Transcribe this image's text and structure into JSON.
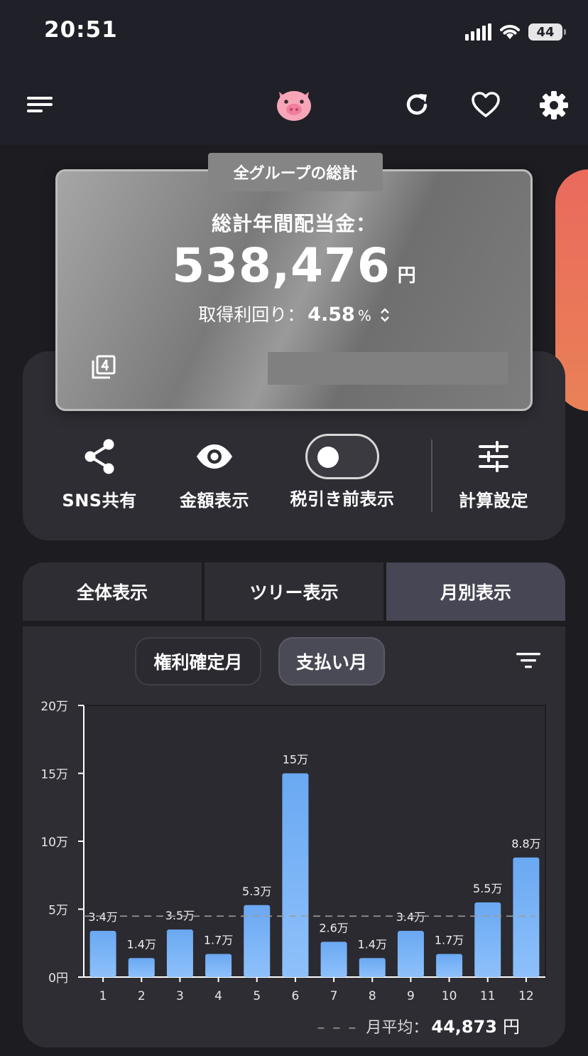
{
  "status_bar": {
    "time": "20:51",
    "battery": "44"
  },
  "app_bar": {
    "menu_icon": "hamburger-menu-icon",
    "logo_icon": "piggy-bank-icon",
    "refresh_icon": "refresh-icon",
    "favorite_icon": "heart-icon",
    "settings_icon": "gear-icon"
  },
  "total_card": {
    "tag": "全グループの総計",
    "label": "総計年間配当金：",
    "amount": "538,476",
    "unit": "円",
    "yield_label": "取得利回り：",
    "yield_value": "4.58",
    "yield_unit": "%",
    "group_count_icon": "group-count-4-icon"
  },
  "controls": {
    "share_label": "SNS共有",
    "amount_label": "金額表示",
    "pretax_label": "税引き前表示",
    "pretax_enabled": false,
    "calc_label": "計算設定"
  },
  "tabs": [
    {
      "label": "全体表示",
      "active": false
    },
    {
      "label": "ツリー表示",
      "active": false
    },
    {
      "label": "月別表示",
      "active": true
    }
  ],
  "chips": {
    "kenri": "権利確定月",
    "shiharai": "支払い月",
    "selected": "支払い月"
  },
  "chart_data": {
    "type": "bar",
    "categories": [
      "1",
      "2",
      "3",
      "4",
      "5",
      "6",
      "7",
      "8",
      "9",
      "10",
      "11",
      "12"
    ],
    "values": [
      34000,
      14000,
      35000,
      17000,
      53000,
      150000,
      26000,
      14000,
      34000,
      17000,
      55000,
      88000
    ],
    "data_labels": [
      "3.4万",
      "1.4万",
      "3.5万",
      "1.7万",
      "5.3万",
      "15万",
      "2.6万",
      "1.4万",
      "3.4万",
      "1.7万",
      "5.5万",
      "8.8万"
    ],
    "y_ticks": [
      0,
      50000,
      100000,
      150000,
      200000
    ],
    "y_tick_labels": [
      "0円",
      "5万",
      "10万",
      "15万",
      "20万"
    ],
    "ylim": [
      0,
      200000
    ],
    "average": 44873,
    "bar_color_top": "#6aa8f2",
    "bar_color_bottom": "#8ec1fb"
  },
  "average": {
    "label": "月平均：",
    "value": "44,873",
    "unit": "円"
  }
}
